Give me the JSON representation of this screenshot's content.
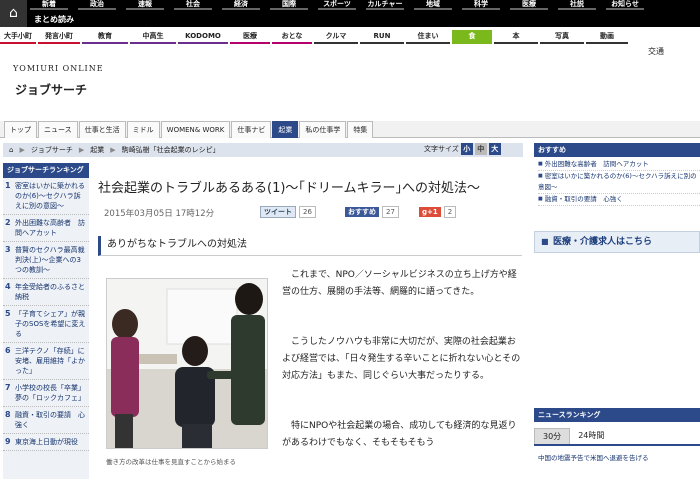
{
  "header": {
    "home_icon": "home-icon",
    "top_nav": [
      "新着",
      "政治",
      "速報",
      "社会",
      "経済",
      "国際",
      "スポーツ",
      "カルチャー",
      "地域",
      "科学",
      "医療",
      "社説",
      "お知らせ"
    ],
    "matome": "まとめ読み",
    "category_nav": [
      {
        "label": "大手小町",
        "color": "#c8102e"
      },
      {
        "label": "発言小町",
        "color": "#c8102e"
      },
      {
        "label": "教育",
        "color": "#6b2d8e"
      },
      {
        "label": "中高生",
        "color": "#6b2d8e"
      },
      {
        "label": "KODOMO",
        "color": "#6b2d8e"
      },
      {
        "label": "医療",
        "color": "#b5006b"
      },
      {
        "label": "おとな",
        "color": "#b5006b"
      },
      {
        "label": "クルマ",
        "color": "#333333"
      },
      {
        "label": "RUN",
        "color": "#333333"
      },
      {
        "label": "住まい",
        "color": "#333333"
      },
      {
        "label": "食",
        "color": "#7ab81c"
      },
      {
        "label": "本",
        "color": "#333333"
      },
      {
        "label": "写真",
        "color": "#333333"
      },
      {
        "label": "動画",
        "color": "#333333"
      }
    ],
    "koutsu": "交通"
  },
  "brand": {
    "site": "YOMIURI ONLINE",
    "section": "ジョブサーチ"
  },
  "tabs": [
    {
      "label": "トップ",
      "active": false
    },
    {
      "label": "ニュース",
      "active": false
    },
    {
      "label": "仕事と生活",
      "active": false
    },
    {
      "label": "ミドル",
      "active": false
    },
    {
      "label": "WOMEN& WORK",
      "active": false
    },
    {
      "label": "仕事ナビ",
      "active": false
    },
    {
      "label": "起業",
      "active": true
    },
    {
      "label": "私の仕事学",
      "active": false
    },
    {
      "label": "特集",
      "active": false
    }
  ],
  "breadcrumb": [
    "ジョブサーチ",
    "起業",
    "駒崎弘樹「社会起業のレシピ」"
  ],
  "font_size": {
    "label": "文字サイズ",
    "small": "小",
    "medium": "中",
    "large": "大"
  },
  "left_sidebar": {
    "heading": "ジョブサーチランキング",
    "items": [
      {
        "num": "1",
        "text": "密室はいかに築かれるのか(6)〜セクハラ訴えに別の意図〜"
      },
      {
        "num": "2",
        "text": "外出困難な高齢者　訪問ヘアカット"
      },
      {
        "num": "3",
        "text": "普賢のセクハラ最高裁判決(上)〜企業への3つの教訓〜"
      },
      {
        "num": "4",
        "text": "年金受給者のふるさと納税"
      },
      {
        "num": "5",
        "text": "「子育てシェア」が親子のSOSを希望に変える"
      },
      {
        "num": "6",
        "text": "三洋テクノ「存続」に安堵、雇用維持「よかった」"
      },
      {
        "num": "7",
        "text": "小学校の校長「卒業」夢の「ロックカフェ」"
      },
      {
        "num": "8",
        "text": "融資・取引の要請　心強く"
      },
      {
        "num": "9",
        "text": "東京海上日動が現役"
      }
    ]
  },
  "article": {
    "title": "社会起業のトラブルあるある(1)〜｢ドリームキラー｣への対処法〜",
    "date": "2015年03月05日 17時12分",
    "tweet": "ツイート",
    "tweet_count": "26",
    "fb": "おすすめ",
    "fb_count": "27",
    "gplus": "g+1",
    "gplus_count": "2",
    "subhead": "ありがちなトラブルへの対処法",
    "caption": "働き方の改革は仕事を見直すことから始まる",
    "paragraphs": [
      "これまで、NPO／ソーシャルビジネスの立ち上げ方や経営の仕方、展開の手法等、網羅的に語ってきた。",
      "こうしたノウハウも非常に大切だが、実際の社会起業および経営では、「日々発生する辛いことに折れない心とその対応方法」もまた、同じぐらい大事だったりする。",
      "特にNPOや社会起業の場合、成功しても経済的な見返りがあるわけでもなく、そもそもそもう"
    ]
  },
  "right_sidebar": {
    "heading": "おすすめ",
    "items": [
      "外出困難な高齢者　訪問ヘアカット",
      "密室はいかに築かれるのか(6)〜セクハラ訴えに別の意図〜",
      "融資・取引の要請　心強く"
    ],
    "banner": "医療・介護求人はこちら",
    "news_rank": {
      "heading": "ニュースランキング",
      "tab_active": "30分",
      "tab_other": "24時間",
      "first": "中国の地震予告で米国へ退避を告げる"
    }
  }
}
